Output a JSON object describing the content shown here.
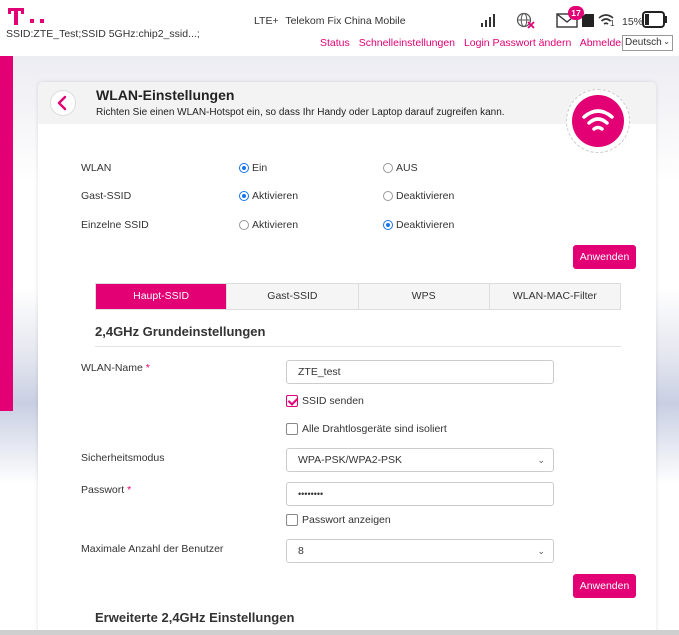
{
  "topbar": {
    "ssid_info": "SSID:ZTE_Test;SSID 5GHz:chip2_ssid...;",
    "network_type": "LTE+",
    "operator": "Telekom Fix China Mobile",
    "message_count": "17",
    "wifi_clients": "1",
    "battery": "15%",
    "nav_links": [
      "Status",
      "Schnelleinstellungen",
      "Login Passwort ändern",
      "Abmelden"
    ],
    "language": "Deutsch",
    "brand_color": "#e20074"
  },
  "header": {
    "title": "WLAN-Einstellungen",
    "subtitle": "Richten Sie einen WLAN-Hotspot ein, so dass Ihr Handy oder Laptop darauf zugreifen kann."
  },
  "settings": {
    "wlan": {
      "label": "WLAN",
      "option_on": "Ein",
      "option_off": "AUS",
      "selected": "Ein"
    },
    "guest_ssid": {
      "label": "Gast-SSID",
      "option_on": "Aktivieren",
      "option_off": "Deaktivieren",
      "selected": "Aktivieren"
    },
    "single_ssid": {
      "label": "Einzelne SSID",
      "option_on": "Aktivieren",
      "option_off": "Deaktivieren",
      "selected": "Deaktivieren"
    },
    "apply_label": "Anwenden"
  },
  "tabs": [
    {
      "label": "Haupt-SSID",
      "active": true
    },
    {
      "label": "Gast-SSID",
      "active": false
    },
    {
      "label": "WPS",
      "active": false
    },
    {
      "label": "WLAN-MAC-Filter",
      "active": false
    }
  ],
  "basic": {
    "section_title": "2,4GHz Grundeinstellungen",
    "wlan_name_label": "WLAN-Name",
    "required_mark": "*",
    "wlan_name_value": "ZTE_test",
    "ssid_broadcast_label": "SSID senden",
    "ssid_broadcast_checked": true,
    "isolate_label": "Alle Drahtlosgeräte sind isoliert",
    "isolate_checked": false,
    "security_label": "Sicherheitsmodus",
    "security_value": "WPA-PSK/WPA2-PSK",
    "password_label": "Passwort",
    "password_value": "••••••••",
    "show_password_label": "Passwort anzeigen",
    "show_password_checked": false,
    "max_users_label": "Maximale Anzahl der Benutzer",
    "max_users_value": "8",
    "apply_label": "Anwenden"
  },
  "advanced": {
    "section_title": "Erweiterte 2,4GHz Einstellungen"
  }
}
